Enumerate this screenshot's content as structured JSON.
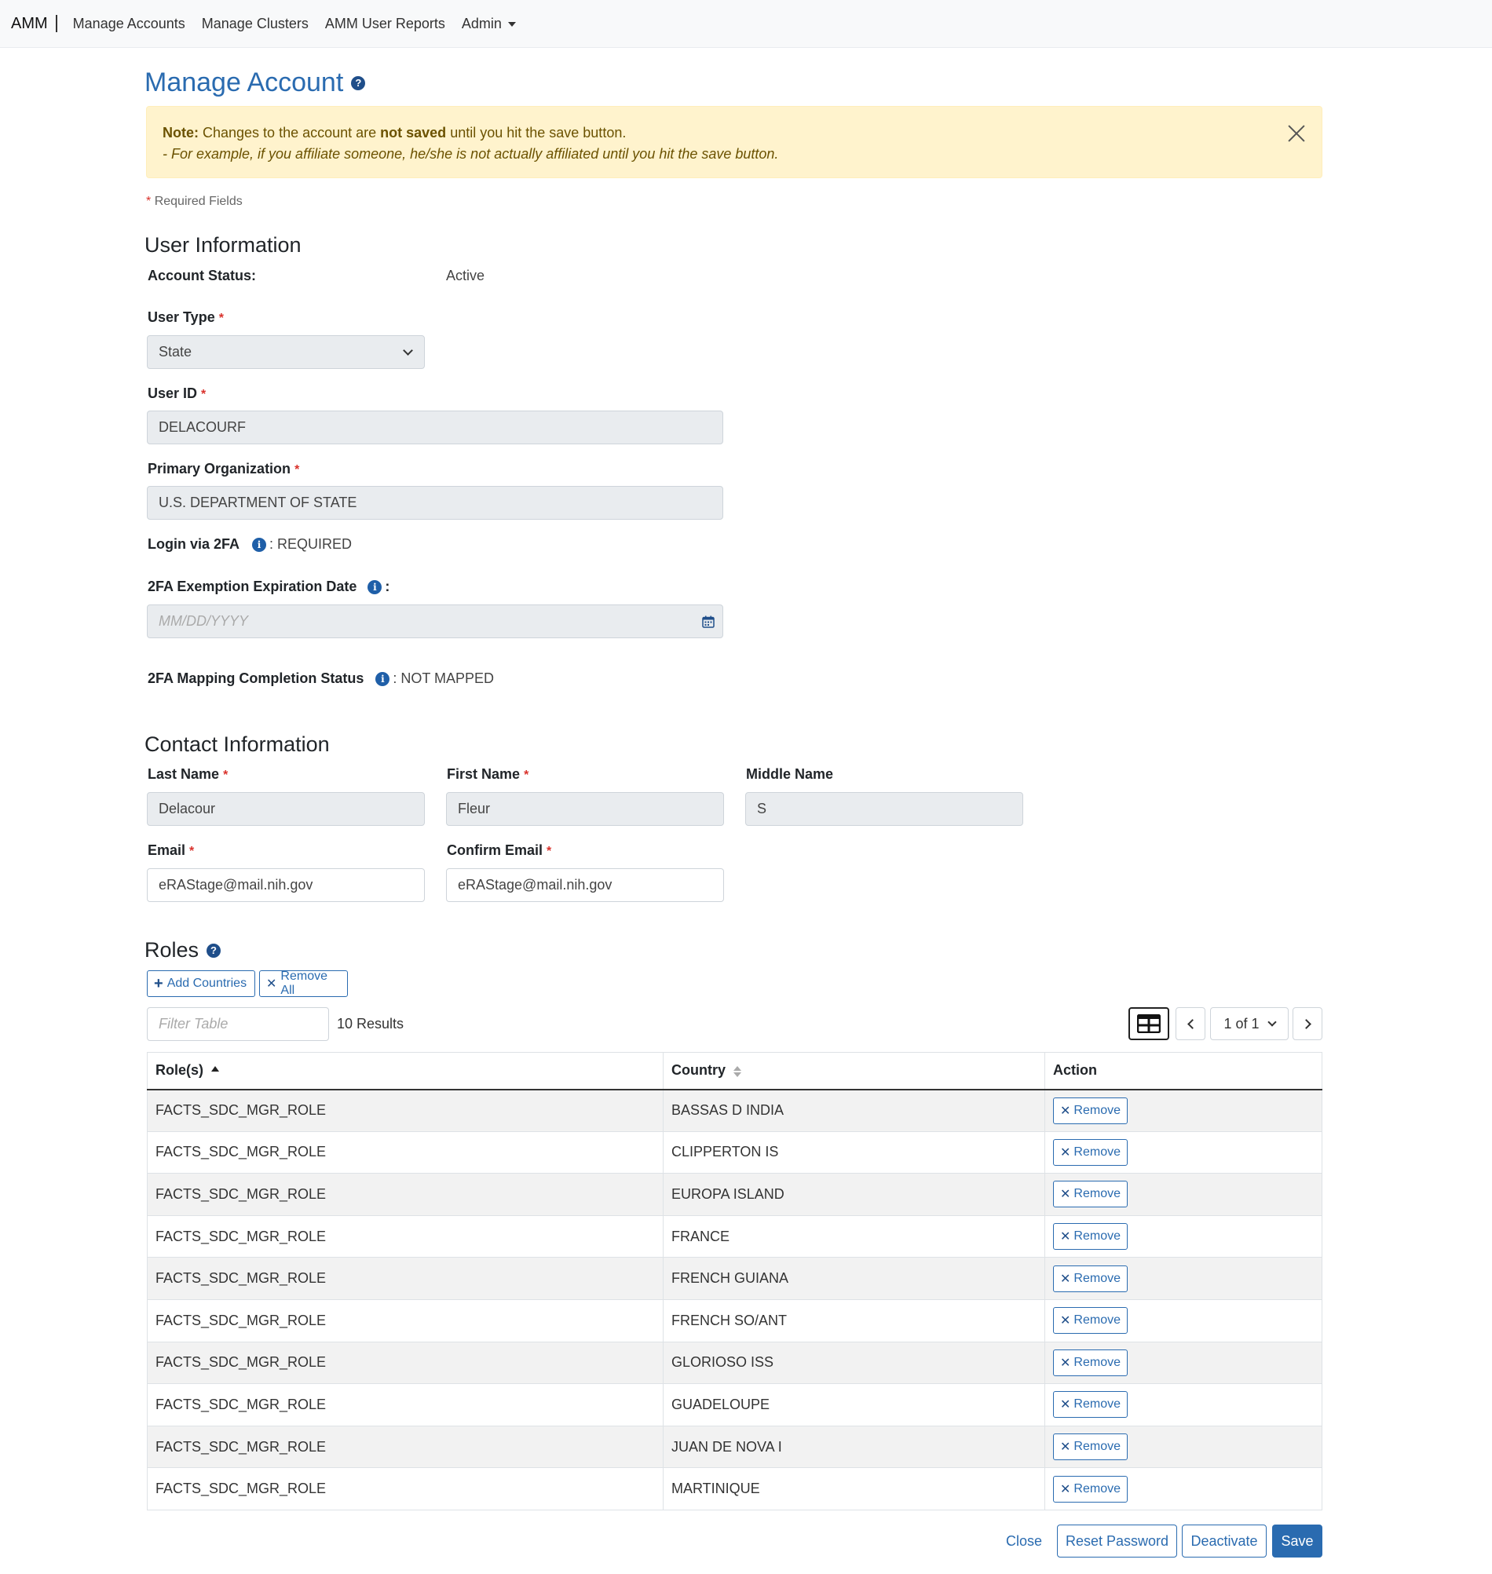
{
  "nav": {
    "brand": "AMM",
    "links": [
      "Manage Accounts",
      "Manage Clusters",
      "AMM User Reports",
      "Admin"
    ]
  },
  "page": {
    "title": "Manage Account"
  },
  "alert": {
    "note_label": "Note:",
    "text_before": " Changes to the account are ",
    "text_bold": "not saved",
    "text_after": " until you hit the save button.",
    "line2": "- For example, if you affiliate someone, he/she is not actually affiliated until you hit the save button."
  },
  "required_fields": "Required Fields",
  "user_info": {
    "heading": "User Information",
    "account_status_label": "Account Status:",
    "account_status_value": "Active",
    "user_type_label": "User Type",
    "user_type_value": "State",
    "user_id_label": "User ID",
    "user_id_value": "DELACOURF",
    "primary_org_label": "Primary Organization",
    "primary_org_value": "U.S. DEPARTMENT OF STATE",
    "login_2fa_label": "Login via 2FA",
    "login_2fa_value": ": REQUIRED",
    "exemption_label": "2FA Exemption Expiration Date",
    "exemption_colon": ":",
    "exemption_placeholder": "MM/DD/YYYY",
    "mapping_label": "2FA Mapping Completion Status",
    "mapping_value": ": NOT MAPPED"
  },
  "contact": {
    "heading": "Contact Information",
    "last_name_label": "Last Name",
    "last_name_value": "Delacour",
    "first_name_label": "First Name",
    "first_name_value": "Fleur",
    "middle_name_label": "Middle Name",
    "middle_name_value": "S",
    "email_label": "Email",
    "email_value": "eRAStage@mail.nih.gov",
    "confirm_email_label": "Confirm Email",
    "confirm_email_value": "eRAStage@mail.nih.gov"
  },
  "roles": {
    "heading": "Roles",
    "add_countries": "Add Countries",
    "remove_all": "Remove All",
    "filter_placeholder": "Filter Table",
    "results": "10 Results",
    "page_indicator": "1 of 1",
    "columns": [
      "Role(s)",
      "Country",
      "Action"
    ],
    "remove_label": "Remove",
    "rows": [
      {
        "role": "FACTS_SDC_MGR_ROLE",
        "country": "BASSAS D INDIA"
      },
      {
        "role": "FACTS_SDC_MGR_ROLE",
        "country": "CLIPPERTON IS"
      },
      {
        "role": "FACTS_SDC_MGR_ROLE",
        "country": "EUROPA ISLAND"
      },
      {
        "role": "FACTS_SDC_MGR_ROLE",
        "country": "FRANCE"
      },
      {
        "role": "FACTS_SDC_MGR_ROLE",
        "country": "FRENCH GUIANA"
      },
      {
        "role": "FACTS_SDC_MGR_ROLE",
        "country": "FRENCH SO/ANT"
      },
      {
        "role": "FACTS_SDC_MGR_ROLE",
        "country": "GLORIOSO ISS"
      },
      {
        "role": "FACTS_SDC_MGR_ROLE",
        "country": "GUADELOUPE"
      },
      {
        "role": "FACTS_SDC_MGR_ROLE",
        "country": "JUAN DE NOVA I"
      },
      {
        "role": "FACTS_SDC_MGR_ROLE",
        "country": "MARTINIQUE"
      }
    ]
  },
  "footer": {
    "close": "Close",
    "reset_password": "Reset Password",
    "deactivate": "Deactivate",
    "save": "Save"
  },
  "colors": {
    "primary": "#2a6bb0",
    "alert_bg": "#fff3cd",
    "required": "#d9312b"
  }
}
